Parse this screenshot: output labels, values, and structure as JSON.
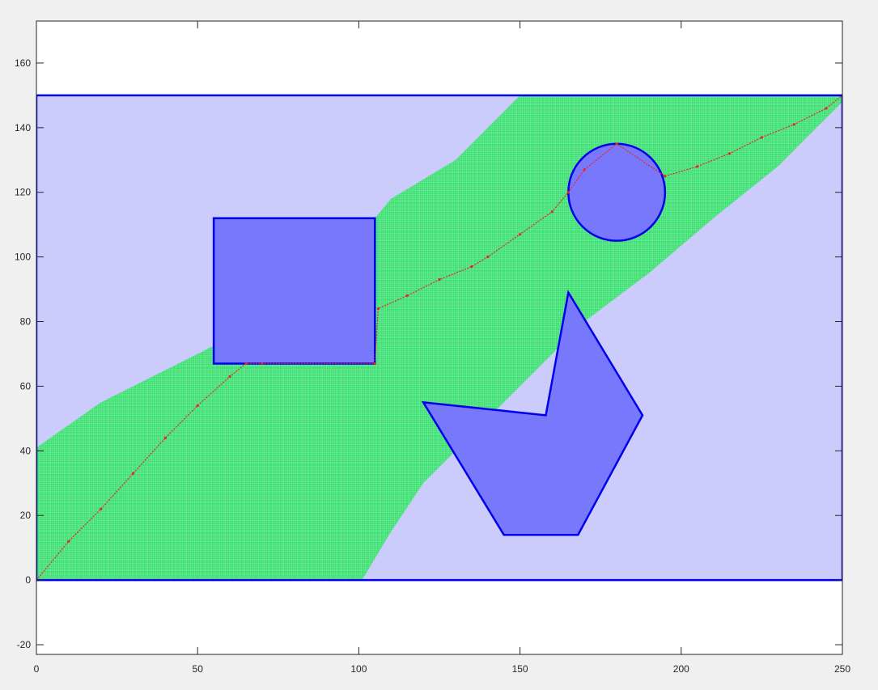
{
  "chart_data": {
    "type": "scatter",
    "title": "",
    "xlabel": "",
    "ylabel": "",
    "xlim": [
      0,
      250
    ],
    "ylim": [
      -23,
      173
    ],
    "xticks": [
      0,
      50,
      100,
      150,
      200,
      250
    ],
    "yticks": [
      -20,
      0,
      20,
      40,
      60,
      80,
      100,
      120,
      140,
      160
    ],
    "grid": false,
    "legend": "none",
    "colors": {
      "workspace_fill": "#ccccfc",
      "obstacle_fill": "#7878fc",
      "outline": "#0000ee",
      "explored": "#38e070",
      "path": "#ee2222",
      "axes_bg": "#ffffff",
      "figure_bg": "#f0f0f0"
    },
    "workspace": {
      "x": [
        0,
        250,
        250,
        0
      ],
      "y": [
        0,
        0,
        150,
        150
      ]
    },
    "explored_region": {
      "x": [
        0,
        0,
        10,
        20,
        40,
        60,
        80,
        95,
        110,
        130,
        150,
        200,
        250,
        250,
        230,
        210,
        190,
        170,
        150,
        130,
        120,
        110,
        101
      ],
      "y": [
        0,
        41,
        48,
        55,
        65,
        75,
        85,
        100,
        118,
        130,
        150,
        150,
        150,
        148,
        128,
        112,
        95,
        80,
        60,
        40,
        30,
        15,
        0
      ]
    },
    "obstacles": [
      {
        "shape": "rectangle",
        "x": [
          55,
          105,
          105,
          55
        ],
        "y": [
          67,
          67,
          112,
          112
        ]
      },
      {
        "shape": "circle",
        "cx": 180,
        "cy": 120,
        "r": 15
      },
      {
        "shape": "polygon",
        "x": [
          120,
          158,
          165,
          188,
          168,
          145
        ],
        "y": [
          55,
          51,
          89,
          51,
          14,
          14
        ]
      }
    ],
    "series": [
      {
        "x": [
          0,
          10,
          20,
          30,
          40,
          50,
          60,
          65,
          70,
          105,
          106,
          115,
          125,
          135,
          140,
          150,
          160,
          165,
          170,
          180,
          195,
          205,
          215,
          225,
          235,
          245,
          250
        ],
        "y": [
          0,
          12,
          22,
          33,
          44,
          54,
          63,
          67,
          67,
          67,
          84,
          88,
          93,
          97,
          100,
          107,
          114,
          120,
          127,
          135,
          125,
          128,
          132,
          137,
          141,
          146,
          150
        ]
      }
    ]
  }
}
